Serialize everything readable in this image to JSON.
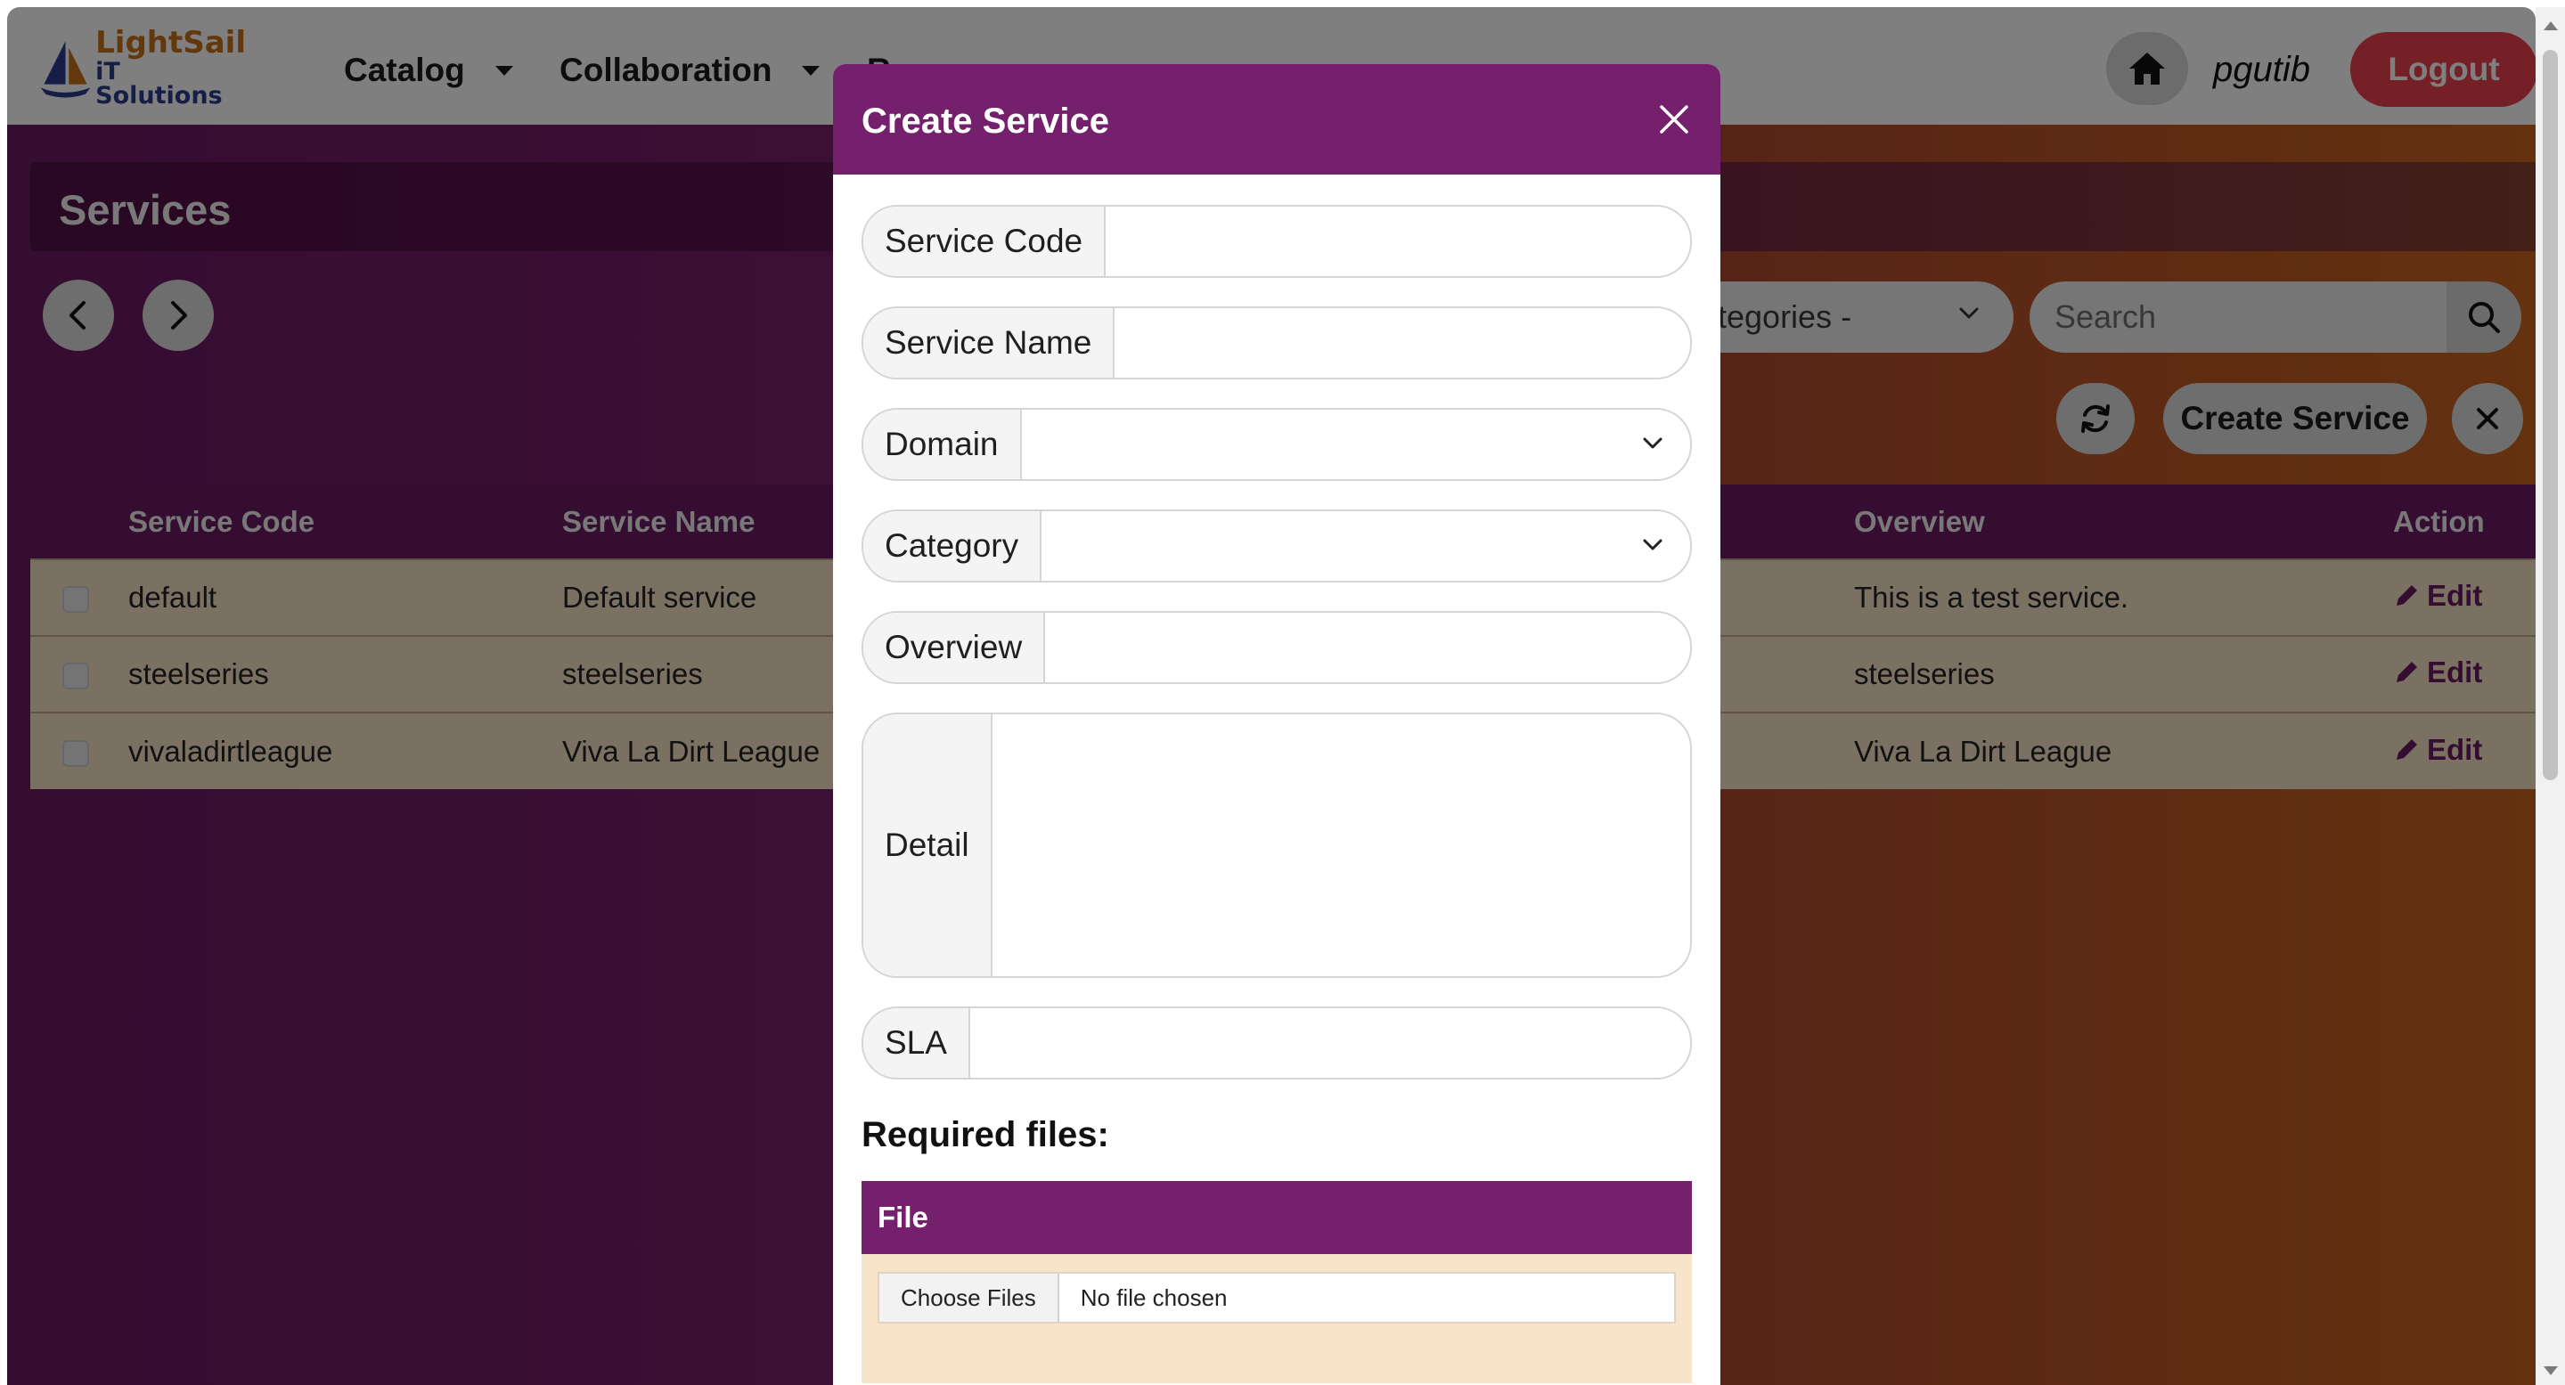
{
  "navbar": {
    "logo_line1": "LightSail",
    "logo_line2": "iT Solutions",
    "menu": [
      {
        "label": "Catalog"
      },
      {
        "label": "Collaboration"
      },
      {
        "label": "R"
      }
    ],
    "username": "pgutib",
    "logout_label": "Logout"
  },
  "services_page": {
    "title": "Services",
    "categories_select": "tegories -",
    "search_placeholder": "Search",
    "create_button": "Create Service",
    "table": {
      "columns": [
        "Service Code",
        "Service Name",
        "Overview",
        "Action"
      ],
      "rows": [
        {
          "code": "default",
          "name": "Default service",
          "overview": "This is a test service.",
          "action": "Edit"
        },
        {
          "code": "steelseries",
          "name": "steelseries",
          "overview": "steelseries",
          "action": "Edit"
        },
        {
          "code": "vivaladirtleague",
          "name": "Viva La Dirt League",
          "overview": "Viva La Dirt League",
          "action": "Edit"
        }
      ]
    }
  },
  "modal": {
    "title": "Create Service",
    "fields": {
      "service_code": {
        "label": "Service Code",
        "value": ""
      },
      "service_name": {
        "label": "Service Name",
        "value": ""
      },
      "domain": {
        "label": "Domain",
        "value": ""
      },
      "category": {
        "label": "Category",
        "value": ""
      },
      "overview": {
        "label": "Overview",
        "value": ""
      },
      "detail": {
        "label": "Detail",
        "value": ""
      },
      "sla": {
        "label": "SLA",
        "value": ""
      }
    },
    "required_files_title": "Required files:",
    "files_table_header": "File",
    "choose_files_label": "Choose Files",
    "no_file_text": "No file chosen"
  },
  "colors": {
    "primary_purple": "#74206d",
    "logout_red": "#e8404c",
    "row_bg": "#f7e2c5"
  }
}
